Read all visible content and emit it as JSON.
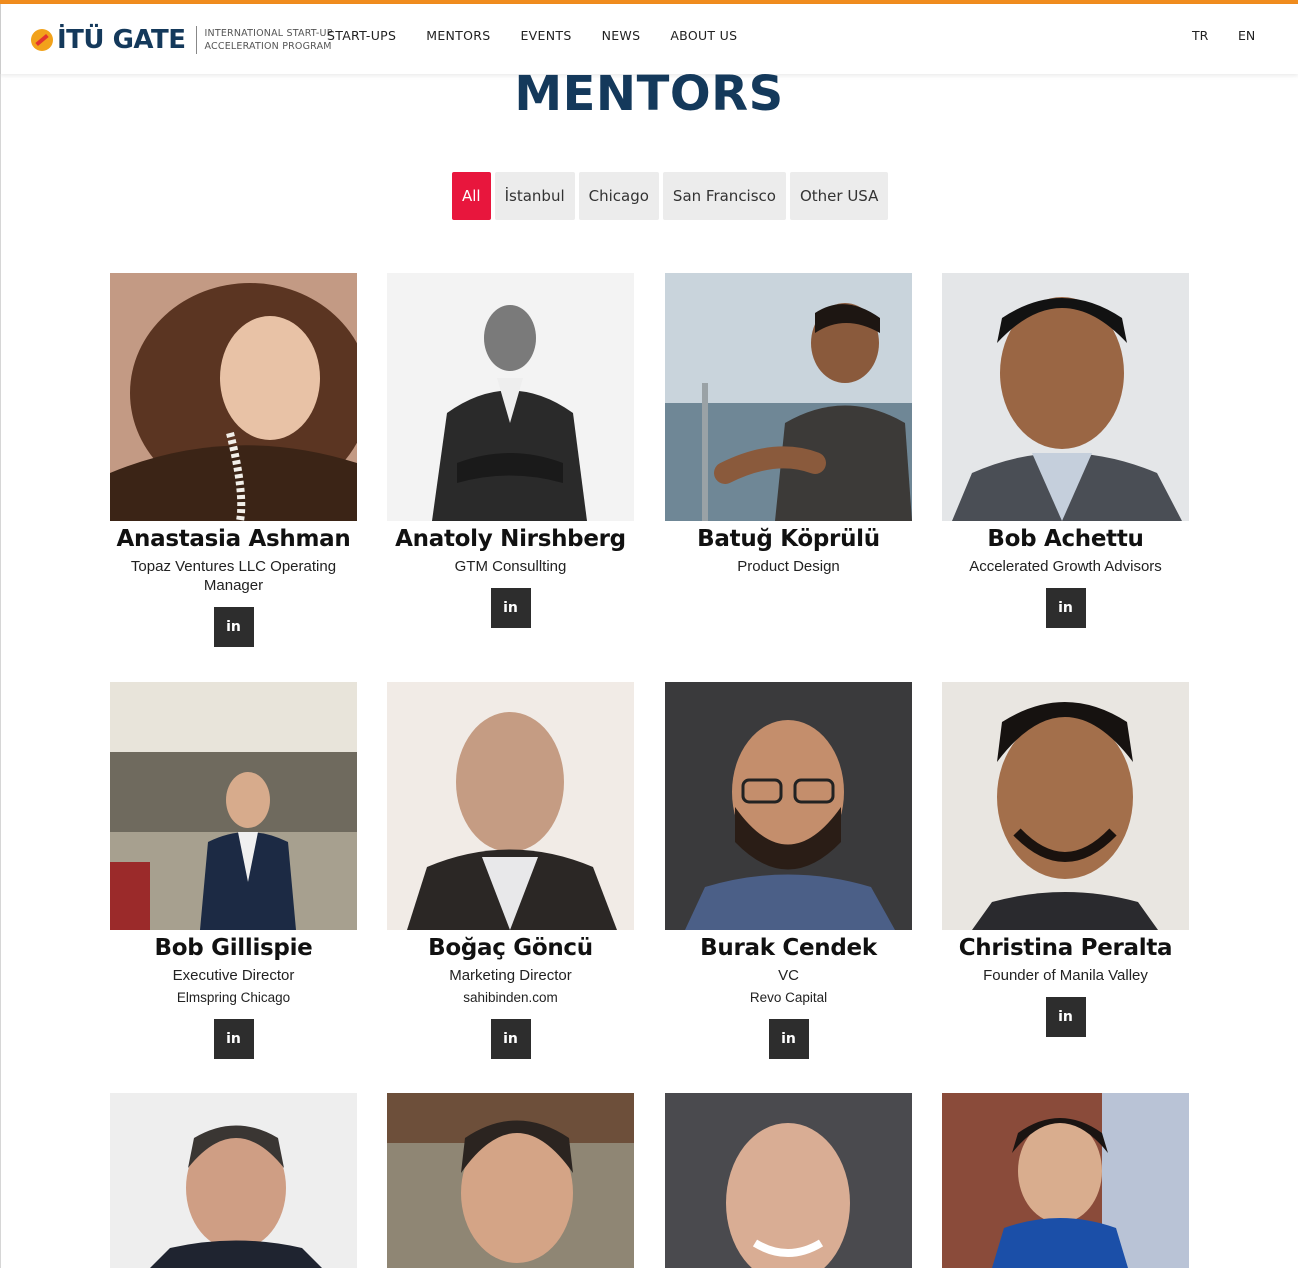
{
  "header": {
    "logo_text": "İTÜ GATE",
    "tagline_line1": "INTERNATIONAL START-UP",
    "tagline_line2": "ACCELERATION PROGRAM",
    "nav": [
      "START-UPS",
      "MENTORS",
      "EVENTS",
      "NEWS",
      "ABOUT US"
    ],
    "lang_tr": "TR",
    "lang_en": "EN"
  },
  "page_title": "MENTORS",
  "filters": [
    "All",
    "İstanbul",
    "Chicago",
    "San Francisco",
    "Other USA"
  ],
  "active_filter": "All",
  "linkedin_label": "in",
  "colors": {
    "accent": "#e8163d",
    "title": "#14395b",
    "topline": "#f08c1e",
    "button": "#2d2d2d"
  },
  "mentors": [
    {
      "name": "Anastasia Ashman",
      "role": "Topaz Ventures LLC Operating Manager",
      "company": "",
      "linkedin": true
    },
    {
      "name": "Anatoly Nirshberg",
      "role": "GTM Consullting",
      "company": "",
      "linkedin": true
    },
    {
      "name": "Batuğ Köprülü",
      "role": "Product Design",
      "company": "",
      "linkedin": false
    },
    {
      "name": "Bob Achettu",
      "role": "Accelerated Growth Advisors",
      "company": "",
      "linkedin": true
    },
    {
      "name": "Bob Gillispie",
      "role": "Executive Director",
      "company": "Elmspring Chicago",
      "linkedin": true
    },
    {
      "name": "Boğaç Göncü",
      "role": "Marketing Director",
      "company": "sahibinden.com",
      "linkedin": true
    },
    {
      "name": "Burak Cendek",
      "role": "VC",
      "company": "Revo Capital",
      "linkedin": true
    },
    {
      "name": "Christina Peralta",
      "role": "Founder of Manila Valley",
      "company": "",
      "linkedin": true
    },
    {
      "name": "",
      "role": "",
      "company": "",
      "linkedin": false
    },
    {
      "name": "",
      "role": "",
      "company": "",
      "linkedin": false
    },
    {
      "name": "",
      "role": "",
      "company": "",
      "linkedin": false
    },
    {
      "name": "",
      "role": "",
      "company": "",
      "linkedin": false
    }
  ]
}
